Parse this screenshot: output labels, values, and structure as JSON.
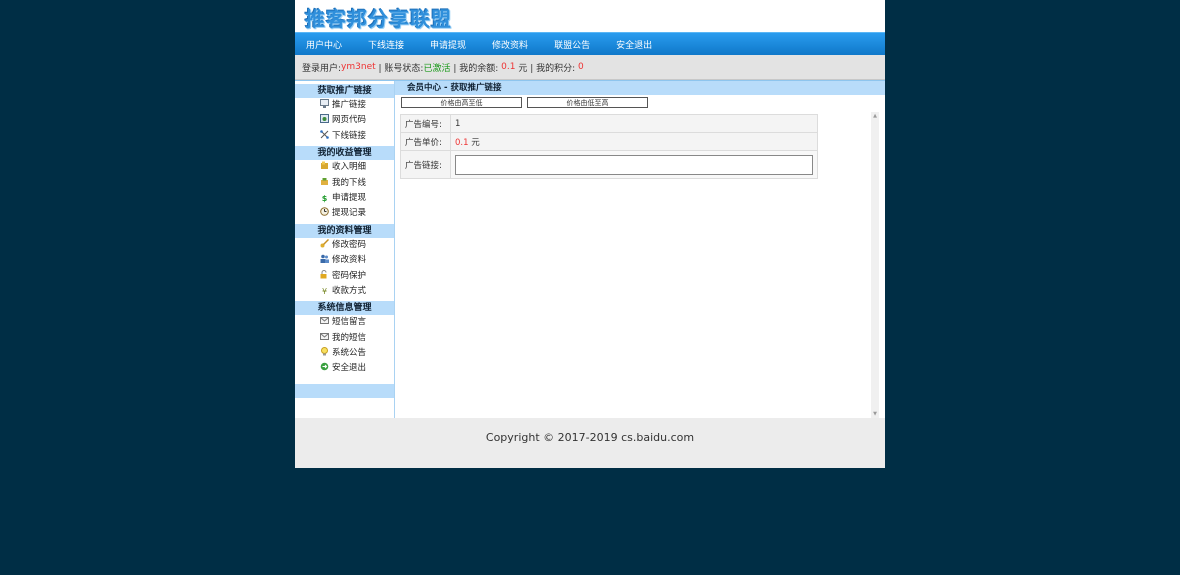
{
  "site": {
    "logo": "推客邦分享联盟"
  },
  "nav": [
    "用户中心",
    "下线连接",
    "申请提现",
    "修改资料",
    "联盟公告",
    "安全退出"
  ],
  "info": {
    "user_label": "登录用户:",
    "user": "ym3net",
    "status_label": "| 账号状态:",
    "status": "已激活",
    "balance_label": "| 我的余额:",
    "balance": "0.1",
    "balance_unit": "元 | 我的积分:",
    "points": "0"
  },
  "sidebar": {
    "groups": [
      {
        "title": "获取推广链接",
        "items": [
          {
            "label": "推广链接",
            "icon": "monitor-icon"
          },
          {
            "label": "网页代码",
            "icon": "webpage-icon"
          },
          {
            "label": "下线链接",
            "icon": "network-icon"
          }
        ]
      },
      {
        "title": "我的收益管理",
        "items": [
          {
            "label": "收入明细",
            "icon": "income-icon"
          },
          {
            "label": "我的下线",
            "icon": "downline-icon"
          },
          {
            "label": "申请提现",
            "icon": "dollar-icon"
          },
          {
            "label": "提现记录",
            "icon": "clock-icon"
          }
        ]
      },
      {
        "title": "我的资料管理",
        "items": [
          {
            "label": "修改密码",
            "icon": "key-icon"
          },
          {
            "label": "修改资料",
            "icon": "users-icon"
          },
          {
            "label": "密码保护",
            "icon": "lock-icon"
          },
          {
            "label": "收款方式",
            "icon": "yen-icon"
          }
        ]
      },
      {
        "title": "系统信息管理",
        "items": [
          {
            "label": "短信留言",
            "icon": "mail-icon"
          },
          {
            "label": "我的短信",
            "icon": "envelope-icon"
          },
          {
            "label": "系统公告",
            "icon": "bulb-icon"
          },
          {
            "label": "安全退出",
            "icon": "exit-icon"
          }
        ]
      }
    ]
  },
  "content": {
    "breadcrumb": "会员中心 - 获取推广链接",
    "sort_desc": "价格由高至低",
    "sort_asc": "价格由低至高",
    "ad_id_label": "广告编号:",
    "ad_id": "1",
    "ad_price_label": "广告单价:",
    "ad_price": "0.1",
    "ad_price_unit": "元",
    "ad_link_label": "广告链接:",
    "ad_link": ""
  },
  "footer": {
    "copyright": "Copyright © 2017-2019 cs.baidu.com"
  },
  "colors": {
    "accent": "#1a8ae0",
    "sidebar_head": "#b8dcfa",
    "page_bg": "#002e45"
  }
}
